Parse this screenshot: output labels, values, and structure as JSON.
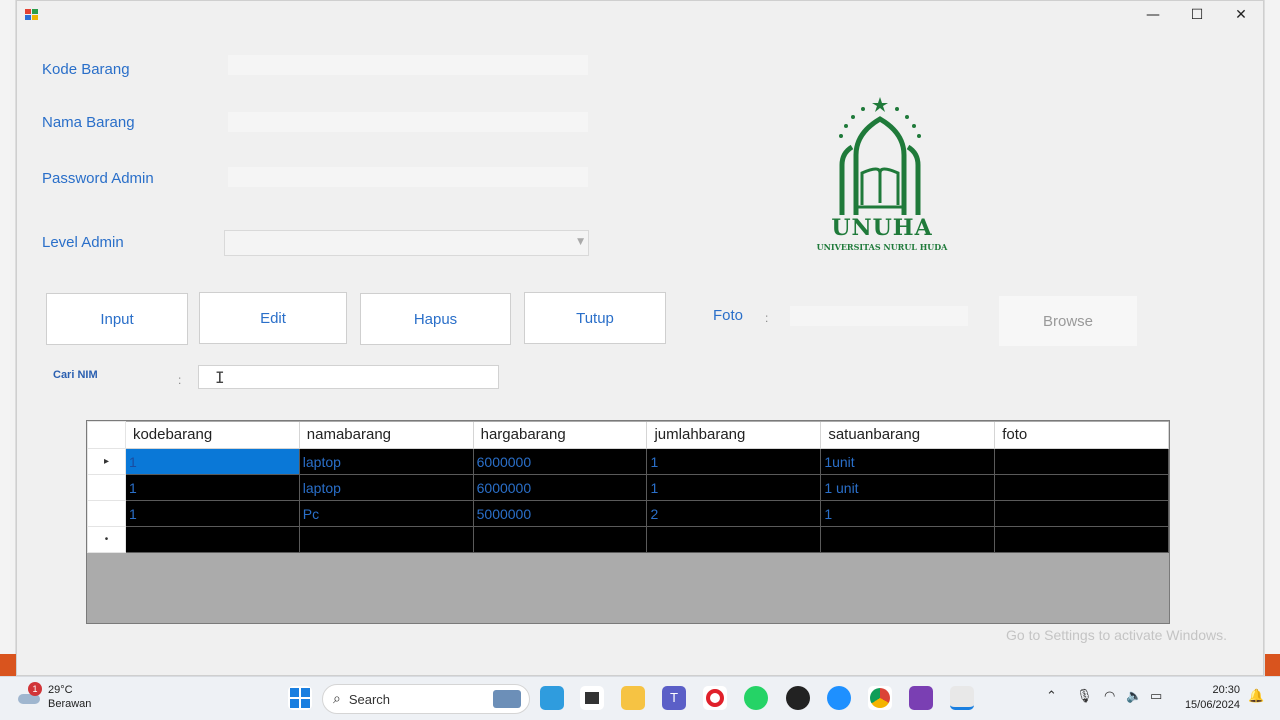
{
  "window": {
    "controls": {
      "minimize": "—",
      "maximize": "☐",
      "close": "✕"
    }
  },
  "form": {
    "kode_label": "Kode Barang",
    "nama_label": "Nama Barang",
    "password_label": "Password Admin",
    "level_label": "Level Admin",
    "foto_label": "Foto",
    "foto_colon": ":",
    "cari_label": "Cari NIM",
    "cari_colon": ":",
    "kode_value": "",
    "nama_value": "",
    "password_value": "",
    "level_value": "",
    "foto_value": "",
    "cari_value": ""
  },
  "buttons": {
    "input": "Input",
    "edit": "Edit",
    "hapus": "Hapus",
    "tutup": "Tutup",
    "browse": "Browse"
  },
  "logo": {
    "name": "UNUHA",
    "subtitle": "UNIVERSITAS NURUL HUDA"
  },
  "grid": {
    "columns": [
      "kodebarang",
      "namabarang",
      "hargabarang",
      "jumlahbarang",
      "satuanbarang",
      "foto"
    ],
    "rows": [
      [
        "1",
        "laptop",
        "6000000",
        "1",
        "1unit",
        ""
      ],
      [
        "1",
        "laptop",
        "6000000",
        "1",
        "1 unit",
        ""
      ],
      [
        "1",
        "Pc",
        "5000000",
        "2",
        "1",
        ""
      ]
    ],
    "current_row_marker": "▸",
    "new_row_marker": "•"
  },
  "watermark": "Go to Settings to activate Windows.",
  "taskbar": {
    "weather_temp": "29°C",
    "weather_desc": "Berawan",
    "weather_badge": "1",
    "search_placeholder": "Search",
    "time": "20:30",
    "date": "15/06/2024"
  },
  "colors": {
    "label_blue": "#2a6fc9",
    "logo_green": "#1f7a3a",
    "grid_black": "#000000",
    "selection_blue": "#0a78d7"
  }
}
